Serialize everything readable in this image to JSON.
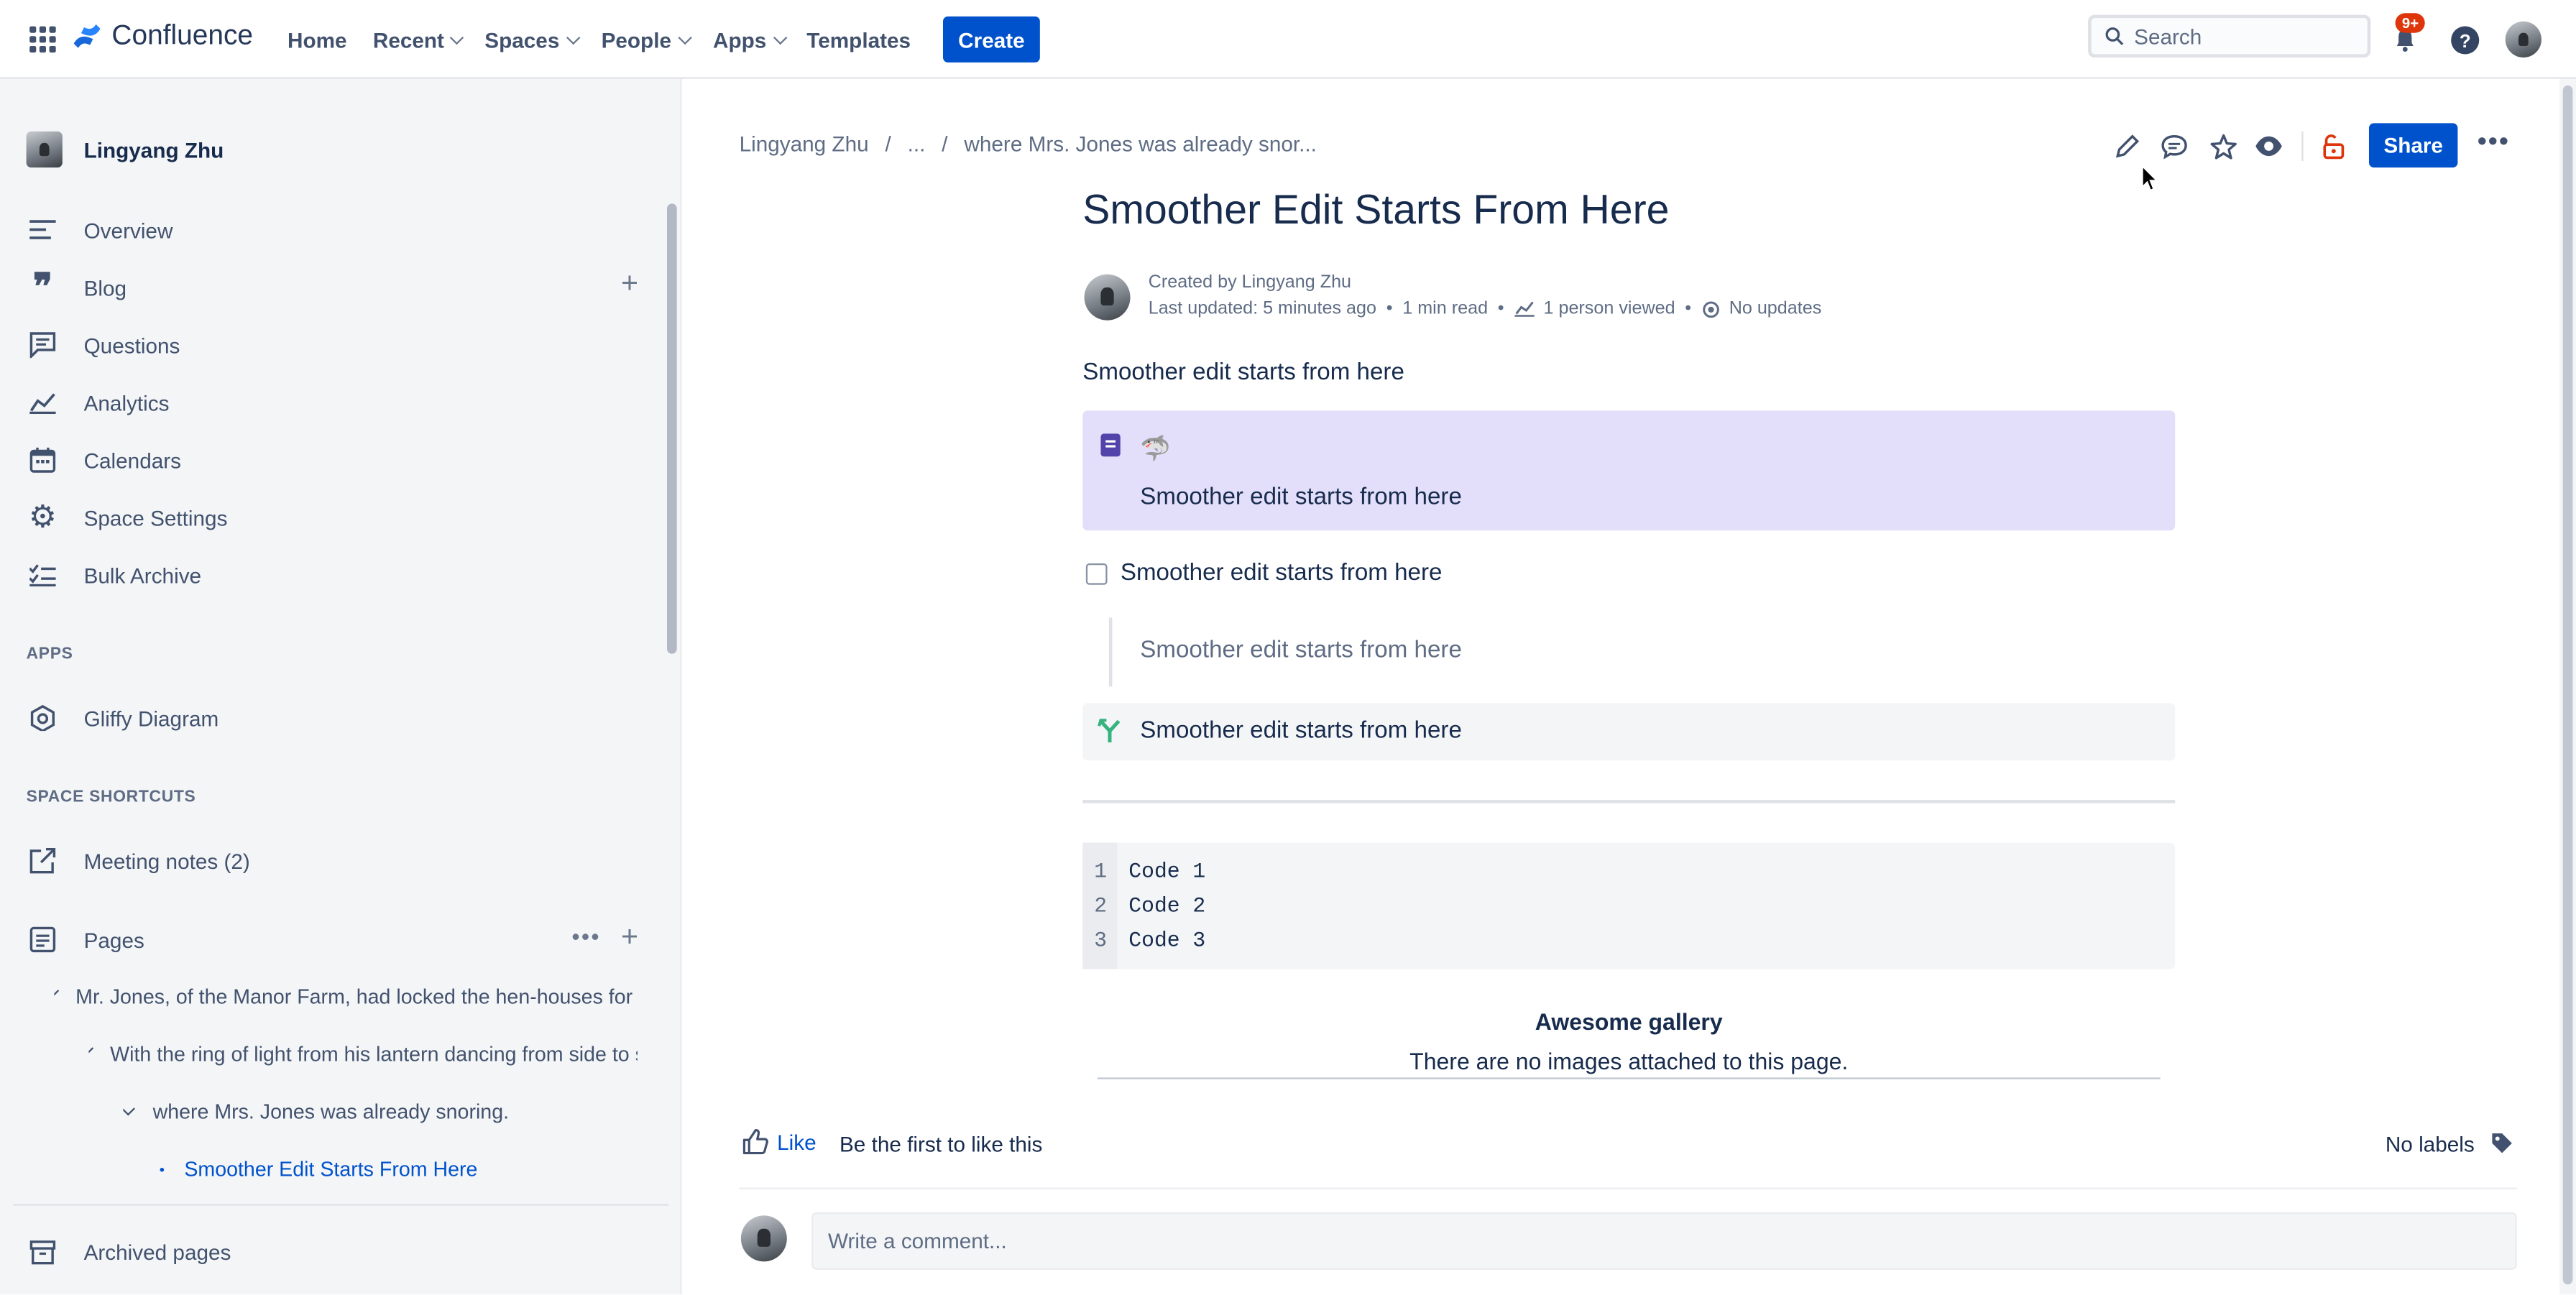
{
  "nav": {
    "logo_text": "Confluence",
    "items": [
      {
        "label": "Home"
      },
      {
        "label": "Recent"
      },
      {
        "label": "Spaces"
      },
      {
        "label": "People"
      },
      {
        "label": "Apps"
      },
      {
        "label": "Templates"
      }
    ],
    "create_label": "Create",
    "search_placeholder": "Search",
    "notification_badge": "9+"
  },
  "sidebar": {
    "space_name": "Lingyang Zhu",
    "items": [
      {
        "label": "Overview",
        "icon": "overview-icon"
      },
      {
        "label": "Blog",
        "icon": "quote-icon"
      },
      {
        "label": "Questions",
        "icon": "questions-icon"
      },
      {
        "label": "Analytics",
        "icon": "analytics-icon"
      },
      {
        "label": "Calendars",
        "icon": "calendar-icon"
      },
      {
        "label": "Space Settings",
        "icon": "gear-icon"
      },
      {
        "label": "Bulk Archive",
        "icon": "checklist-icon"
      }
    ],
    "apps_heading": "APPS",
    "apps": [
      {
        "label": "Gliffy Diagram",
        "icon": "gliffy-icon"
      }
    ],
    "shortcuts_heading": "SPACE SHORTCUTS",
    "shortcuts": [
      {
        "label": "Meeting notes (2)",
        "icon": "external-link-icon"
      }
    ],
    "pages_label": "Pages",
    "tree": [
      {
        "label": "Mr. Jones, of the Manor Farm, had locked the hen-houses for the night"
      },
      {
        "label": "With the ring of light from his lantern dancing from side to side"
      },
      {
        "label": "where Mrs. Jones was already snoring."
      },
      {
        "label": "Smoother Edit Starts From Here"
      }
    ],
    "archived_label": "Archived pages"
  },
  "breadcrumb": {
    "root": "Lingyang Zhu",
    "ellipsis": "...",
    "parent": "where Mrs. Jones was already snor..."
  },
  "page": {
    "title": "Smoother Edit Starts From Here",
    "created_by": "Created by Lingyang Zhu",
    "last_updated": "Last updated: 5 minutes ago",
    "read_time": "1 min read",
    "viewed": "1 person viewed",
    "updates": "No updates",
    "share_label": "Share",
    "paragraph": "Smoother edit starts from here",
    "panel_text": "Smoother edit starts from here",
    "task_text": "Smoother edit starts from here",
    "quote_text": "Smoother edit starts from here",
    "decision_text": "Smoother edit starts from here",
    "code": [
      {
        "n": "1",
        "text": "Code 1"
      },
      {
        "n": "2",
        "text": "Code 2"
      },
      {
        "n": "3",
        "text": "Code 3"
      }
    ],
    "gallery_title": "Awesome gallery",
    "gallery_empty": "There are no images attached to this page."
  },
  "footer": {
    "like_label": "Like",
    "first_like": "Be the first to like this",
    "no_labels": "No labels",
    "comment_placeholder": "Write a comment..."
  },
  "colors": {
    "brand": "#0052cc",
    "panel": "#e3dffa",
    "sidebar": "#f4f5f7"
  }
}
